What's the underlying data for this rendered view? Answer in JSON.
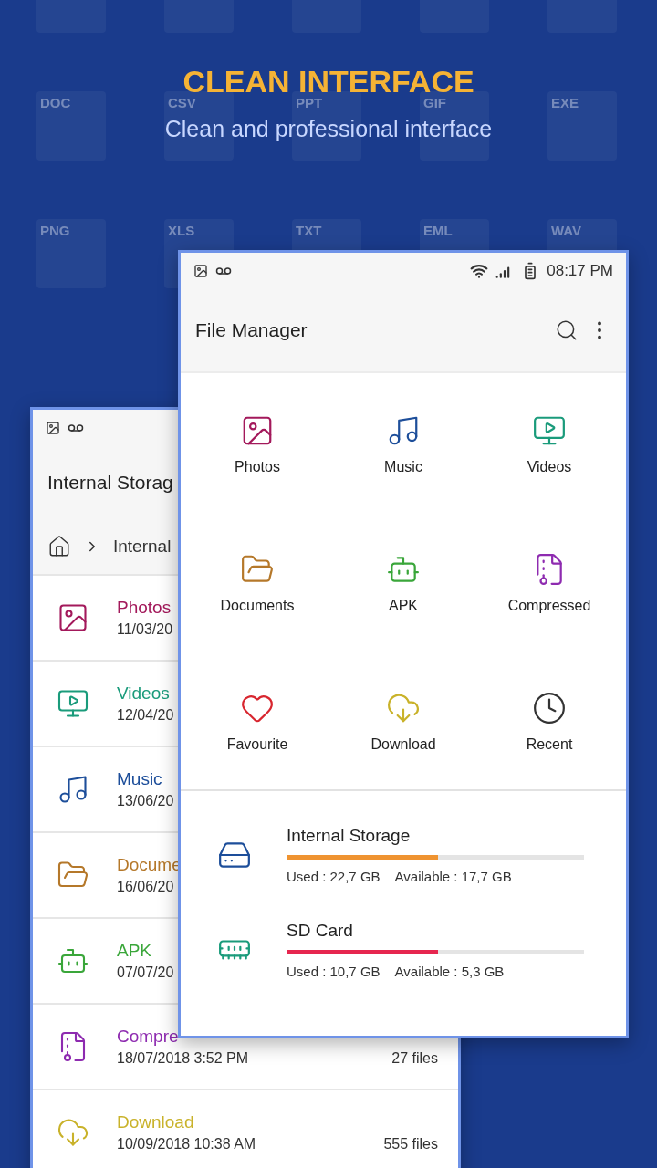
{
  "background_tiles": [
    {
      "label": "DOC"
    },
    {
      "label": "CSV"
    },
    {
      "label": "PPT"
    },
    {
      "label": "GIF"
    },
    {
      "label": "EXE"
    },
    {
      "label": "PNG"
    },
    {
      "label": "XLS"
    },
    {
      "label": "TXT"
    },
    {
      "label": "EML"
    },
    {
      "label": "WAV"
    }
  ],
  "headline": {
    "title": "CLEAN INTERFACE",
    "subtitle": "Clean and professional interface"
  },
  "back_phone": {
    "title": "Internal Storag",
    "breadcrumb": "Internal",
    "rows": [
      {
        "name": "Photos",
        "date": "11/03/20",
        "color": "#a3195b"
      },
      {
        "name": "Videos",
        "date": "12/04/20",
        "color": "#1a9b7b"
      },
      {
        "name": "Music",
        "date": "13/06/20",
        "color": "#1d4e9a"
      },
      {
        "name": "Docume",
        "date": "16/06/20",
        "color": "#b5782a"
      },
      {
        "name": "APK",
        "date": "07/07/20",
        "color": "#3aa63a"
      },
      {
        "name": "Compre",
        "date": "18/07/2018 3:52 PM",
        "count": "27 files",
        "color": "#8e2bb0"
      },
      {
        "name": "Download",
        "date": "10/09/2018 10:38 AM",
        "count": "555 files",
        "color": "#c9b22a"
      }
    ]
  },
  "front_phone": {
    "status_time": "08:17 PM",
    "title": "File Manager",
    "categories": [
      {
        "label": "Photos",
        "color": "#a3195b"
      },
      {
        "label": "Music",
        "color": "#1d4e9a"
      },
      {
        "label": "Videos",
        "color": "#1a9b7b"
      },
      {
        "label": "Documents",
        "color": "#b5782a"
      },
      {
        "label": "APK",
        "color": "#3aa63a"
      },
      {
        "label": "Compressed",
        "color": "#8e2bb0"
      },
      {
        "label": "Favourite",
        "color": "#d8262f"
      },
      {
        "label": "Download",
        "color": "#c9b22a"
      },
      {
        "label": "Recent",
        "color": "#333333"
      }
    ],
    "storage": [
      {
        "name": "Internal Storage",
        "level": 0.51,
        "color": "#ef9330",
        "used": "Used : 22,7 GB",
        "available": "Available : 17,7 GB"
      },
      {
        "name": "SD Card",
        "level": 0.51,
        "color": "#e6264f",
        "used": "Used : 10,7 GB",
        "available": "Available : 5,3 GB"
      }
    ]
  }
}
